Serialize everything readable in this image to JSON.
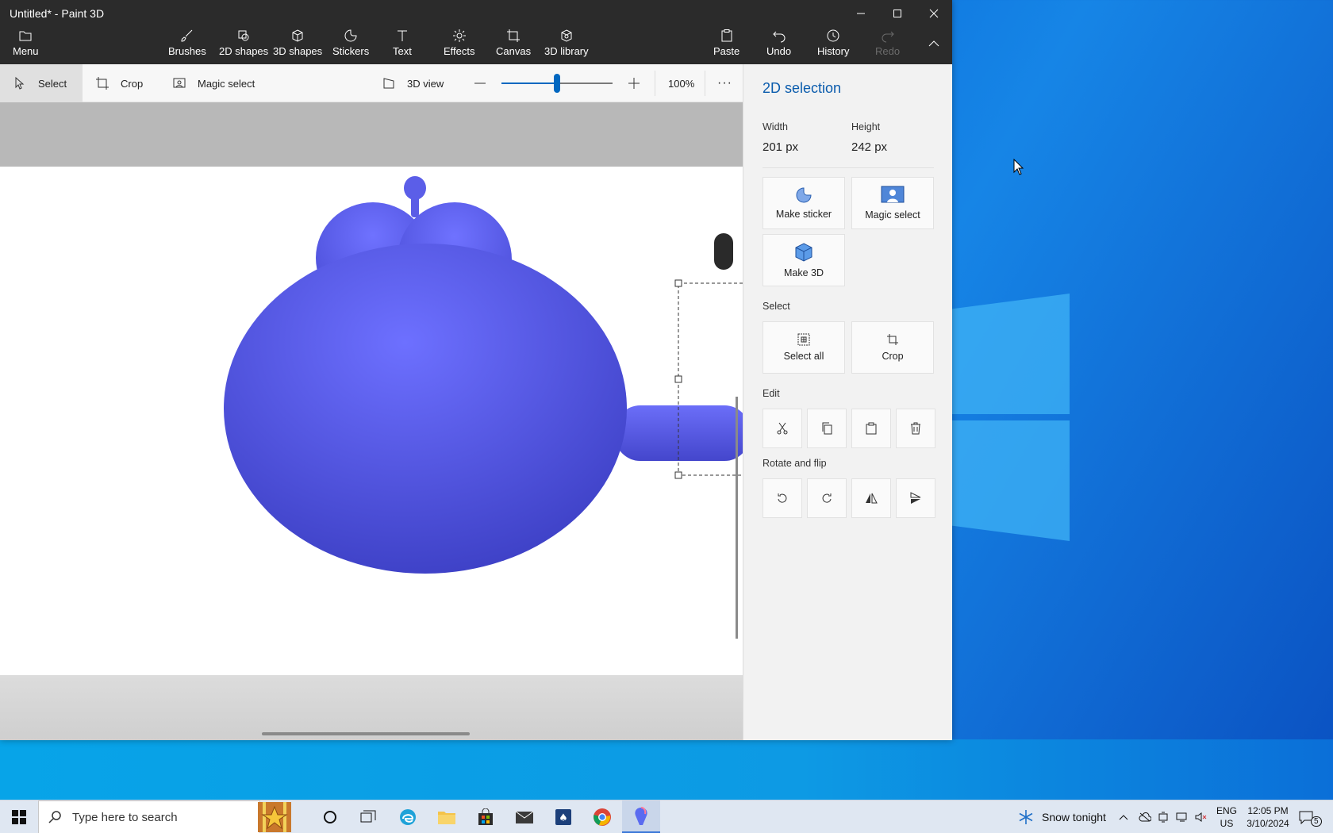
{
  "window": {
    "title": "Untitled* - Paint 3D"
  },
  "ribbon": {
    "menu": "Menu",
    "brushes": "Brushes",
    "shapes2d": "2D shapes",
    "shapes3d": "3D shapes",
    "stickers": "Stickers",
    "text": "Text",
    "effects": "Effects",
    "canvas": "Canvas",
    "library3d": "3D library",
    "paste": "Paste",
    "undo": "Undo",
    "history": "History",
    "redo": "Redo"
  },
  "toolbar": {
    "select": "Select",
    "crop": "Crop",
    "magic_select": "Magic select",
    "view3d": "3D view",
    "zoom_value": "100%",
    "zoom_level": 0.5
  },
  "panel": {
    "title": "2D selection",
    "width_label": "Width",
    "height_label": "Height",
    "width_value": "201 px",
    "height_value": "242 px",
    "make_sticker": "Make sticker",
    "magic_select": "Magic select",
    "make_3d": "Make 3D",
    "select_header": "Select",
    "select_all": "Select all",
    "crop": "Crop",
    "edit_header": "Edit",
    "rotate_header": "Rotate and flip"
  },
  "taskbar": {
    "search_placeholder": "Type here to search",
    "weather": "Snow tonight",
    "lang_top": "ENG",
    "lang_bottom": "US",
    "time": "12:05 PM",
    "date": "3/10/2024",
    "notifications": "5"
  },
  "colors": {
    "shape_blue": "#5a5ef0",
    "accent": "#0067c0"
  }
}
